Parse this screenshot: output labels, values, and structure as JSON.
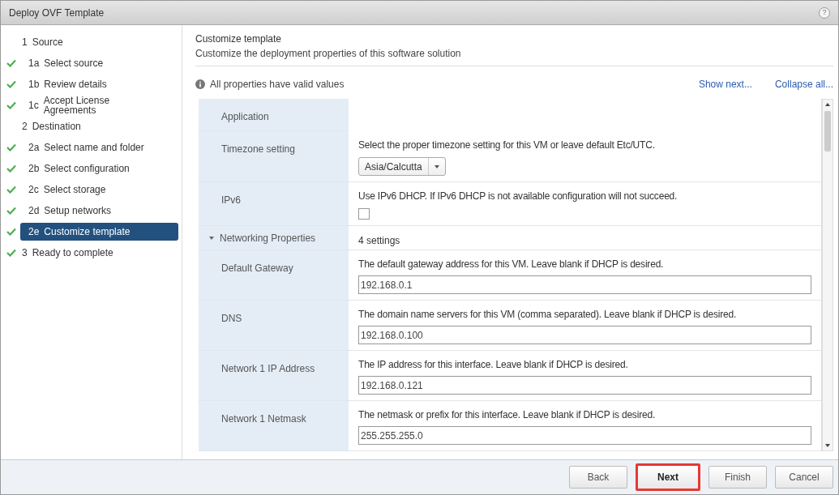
{
  "window": {
    "title": "Deploy OVF Template",
    "help": "?"
  },
  "steps": [
    {
      "kind": "section",
      "number": "1",
      "label": "Source",
      "done": false,
      "selected": false
    },
    {
      "kind": "step",
      "number": "1a",
      "label": "Select source",
      "done": true,
      "selected": false
    },
    {
      "kind": "step",
      "number": "1b",
      "label": "Review details",
      "done": true,
      "selected": false
    },
    {
      "kind": "step",
      "number": "1c",
      "label": "Accept License Agreements",
      "done": true,
      "selected": false
    },
    {
      "kind": "section",
      "number": "2",
      "label": "Destination",
      "done": false,
      "selected": false
    },
    {
      "kind": "step",
      "number": "2a",
      "label": "Select name and folder",
      "done": true,
      "selected": false
    },
    {
      "kind": "step",
      "number": "2b",
      "label": "Select configuration",
      "done": true,
      "selected": false
    },
    {
      "kind": "step",
      "number": "2c",
      "label": "Select storage",
      "done": true,
      "selected": false
    },
    {
      "kind": "step",
      "number": "2d",
      "label": "Setup networks",
      "done": true,
      "selected": false
    },
    {
      "kind": "step",
      "number": "2e",
      "label": "Customize template",
      "done": true,
      "selected": true
    },
    {
      "kind": "section",
      "number": "3",
      "label": "Ready to complete",
      "done": true,
      "selected": false
    }
  ],
  "header": {
    "title": "Customize template",
    "subtitle": "Customize the deployment properties of this software solution"
  },
  "status": {
    "text": "All properties have valid values",
    "links": [
      "Show next...",
      "Collapse all..."
    ]
  },
  "properties": [
    {
      "kind": "section",
      "label": "Application"
    },
    {
      "kind": "select",
      "label": "Timezone setting",
      "description": "Select the proper timezone setting for this VM or leave default Etc/UTC.",
      "value": "Asia/Calcutta"
    },
    {
      "kind": "checkbox",
      "label": "IPv6",
      "description": "Use IPv6 DHCP. If IPv6 DHCP is not available configuration will not succeed.",
      "checked": false
    },
    {
      "kind": "group",
      "label": "Networking Properties",
      "expanded": true,
      "summary": "4 settings"
    },
    {
      "kind": "text",
      "label": "Default Gateway",
      "description": "The default gateway address for this VM. Leave blank if DHCP is desired.",
      "value": "192.168.0.1"
    },
    {
      "kind": "text",
      "label": "DNS",
      "description": "The domain name servers for this VM (comma separated). Leave blank if DHCP is desired.",
      "value": "192.168.0.100"
    },
    {
      "kind": "text",
      "label": "Network 1 IP Address",
      "description": "The IP address for this interface. Leave blank if DHCP is desired.",
      "value": "192.168.0.121"
    },
    {
      "kind": "text",
      "label": "Network 1 Netmask",
      "description": "The netmask or prefix for this interface. Leave blank if DHCP is desired.",
      "value": "255.255.255.0"
    }
  ],
  "buttons": [
    {
      "label": "Back",
      "highlighted": false
    },
    {
      "label": "Next",
      "highlighted": true
    },
    {
      "label": "Finish",
      "highlighted": false
    },
    {
      "label": "Cancel",
      "highlighted": false
    }
  ]
}
